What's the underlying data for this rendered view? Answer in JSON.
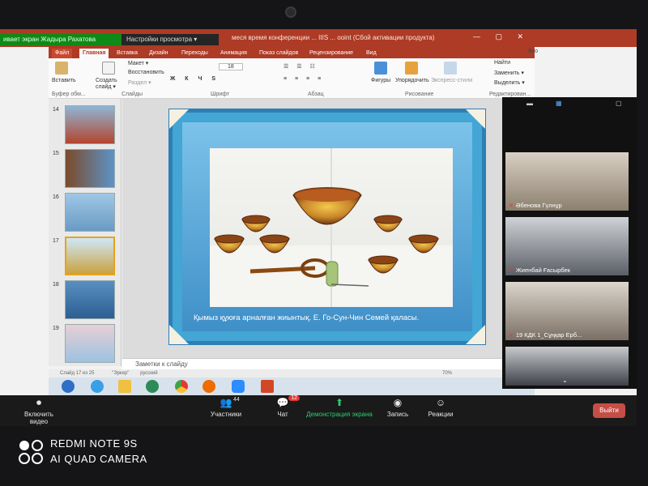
{
  "zoom": {
    "share_banner": "ивает экран Жадыра Рахатова",
    "view_options": "Настройки просмотра ▾",
    "buttons": {
      "video": "Включить видео",
      "participants": "Участники",
      "participants_count": "44",
      "chat": "Чат",
      "chat_badge": "12",
      "share": "Демонстрация экрана",
      "record": "Запись",
      "reactions": "Реакции",
      "leave": "Выйти"
    },
    "participants": [
      {
        "name": "Әбенова Гүлнұр"
      },
      {
        "name": "Жиенбай Ғасырбек"
      },
      {
        "name": "19 КДК 1_Сұңқар Ерб..."
      },
      {
        "name": ""
      }
    ]
  },
  "powerpoint": {
    "title": "меся время конференции ... IIIS ... ooint (Сбой активации продукта)",
    "login": "Вхо",
    "tabs": [
      "Файл",
      "Главная",
      "Вставка",
      "Дизайн",
      "Переходы",
      "Анимация",
      "Показ слайдов",
      "Рецензирование",
      "Вид"
    ],
    "active_tab": "Главная",
    "ribbon": {
      "insert_label": "Вставить",
      "create_slide": "Создать слайд ▾",
      "layout": "Макет ▾",
      "restore": "Восстановить",
      "section": "Раздел ▾",
      "groups": [
        "Буфер обм...",
        "Слайды",
        "Шрифт",
        "Абзац",
        "Рисование",
        "Редактирован..."
      ],
      "shapes": "Фигуры",
      "arrange": "Упорядочить",
      "express": "Экспресс-стили",
      "find": "Найти",
      "replace": "Заменить ▾",
      "select": "Выделить ▾",
      "font_size": "18"
    },
    "thumbnails": [
      {
        "num": "14"
      },
      {
        "num": "15"
      },
      {
        "num": "16"
      },
      {
        "num": "17"
      },
      {
        "num": "18"
      },
      {
        "num": "19"
      }
    ],
    "selected_slide": "17",
    "slide": {
      "caption": "Қымыз құюға арналған жиынтық. Е. Го-Сун-Чин Семей қаласы."
    },
    "notes_placeholder": "Заметки к слайду",
    "status": {
      "slide_of": "Слайд 17 из 25",
      "theme": "\"Эркер\"",
      "lang": "русский",
      "zoom": "70%"
    }
  },
  "phone_watermark": {
    "line1": "REDMI NOTE 9S",
    "line2": "AI QUAD CAMERA"
  },
  "colors": {
    "ppt_accent": "#ad3b25",
    "zoom_bar": "#1a1a1a",
    "share_green": "#0e8a16",
    "leave_red": "#c64e47"
  }
}
